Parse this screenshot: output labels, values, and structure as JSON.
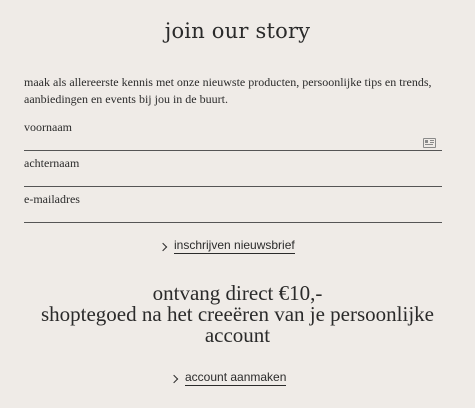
{
  "header": {
    "title": "join our story"
  },
  "intro": {
    "text": "maak als allereerste kennis met onze nieuwste producten, persoonlijke tips en trends, aanbiedingen en events bij jou in de buurt."
  },
  "form": {
    "first_name": {
      "label": "voornaam",
      "value": ""
    },
    "last_name": {
      "label": "achternaam",
      "value": ""
    },
    "email": {
      "label": "e-mailadres",
      "value": ""
    },
    "submit_label": "inschrijven nieuwsbrief"
  },
  "promo": {
    "line1": "ontvang direct €10,-",
    "line2": "shoptegoed na het creeëren van je persoonlijke",
    "line3": "account",
    "cta_label": "account aanmaken"
  },
  "icons": {
    "autofill": "contact-card-icon",
    "chevron": "chevron-right-icon"
  },
  "colors": {
    "background": "#efebe7",
    "text": "#2b2b2b"
  }
}
